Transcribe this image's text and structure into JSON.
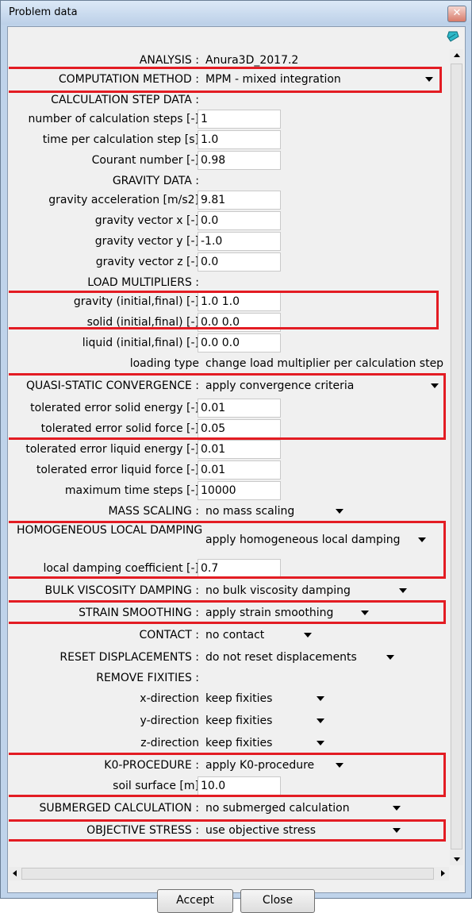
{
  "window": {
    "title": "Problem data",
    "close_glyph": "✕"
  },
  "analysis": {
    "label": "ANALYSIS :",
    "value": "Anura3D_2017.2"
  },
  "computation_method": {
    "label": "COMPUTATION METHOD :",
    "value": "MPM - mixed integration"
  },
  "calc_step": {
    "header": "CALCULATION STEP DATA :",
    "num_steps": {
      "label": "number of calculation steps [-]",
      "value": "1"
    },
    "time_per_step": {
      "label": "time per calculation step [s]",
      "value": "1.0"
    },
    "courant": {
      "label": "Courant number [-]",
      "value": "0.98"
    }
  },
  "gravity": {
    "header": "GRAVITY DATA :",
    "accel": {
      "label": "gravity acceleration [m/s2]",
      "value": "9.81"
    },
    "vx": {
      "label": "gravity vector x [-]",
      "value": "0.0"
    },
    "vy": {
      "label": "gravity vector y [-]",
      "value": "-1.0"
    },
    "vz": {
      "label": "gravity vector z [-]",
      "value": "0.0"
    }
  },
  "load_multipliers": {
    "header": "LOAD MULTIPLIERS :",
    "gravity": {
      "label": "gravity (initial,final) [-]",
      "value": "1.0  1.0"
    },
    "solid": {
      "label": "solid (initial,final) [-]",
      "value": "0.0  0.0"
    },
    "liquid": {
      "label": "liquid (initial,final) [-]",
      "value": "0.0  0.0"
    },
    "loading_type": {
      "label": "loading type",
      "value": "change load multiplier per calculation step"
    }
  },
  "quasi_static": {
    "label": "QUASI-STATIC CONVERGENCE :",
    "value": "apply convergence criteria",
    "err_solid_energy": {
      "label": "tolerated error solid energy [-]",
      "value": "0.01"
    },
    "err_solid_force": {
      "label": "tolerated error solid force [-]",
      "value": "0.05"
    },
    "err_liquid_energy": {
      "label": "tolerated error liquid energy [-]",
      "value": "0.01"
    },
    "err_liquid_force": {
      "label": "tolerated error liquid force [-]",
      "value": "0.01"
    },
    "max_time_steps": {
      "label": "maximum time steps [-]",
      "value": "10000"
    }
  },
  "mass_scaling": {
    "label": "MASS SCALING :",
    "value": "no mass scaling"
  },
  "local_damping": {
    "label": "HOMOGENEOUS LOCAL DAMPING",
    "value": "apply homogeneous local damping",
    "coef": {
      "label": "local damping coefficient [-]",
      "value": "0.7"
    }
  },
  "bulk_viscosity": {
    "label": "BULK VISCOSITY DAMPING :",
    "value": "no bulk viscosity damping"
  },
  "strain_smoothing": {
    "label": "STRAIN SMOOTHING :",
    "value": "apply strain smoothing"
  },
  "contact": {
    "label": "CONTACT :",
    "value": "no contact"
  },
  "reset_displacements": {
    "label": "RESET DISPLACEMENTS :",
    "value": "do not reset displacements"
  },
  "remove_fixities": {
    "header": "REMOVE FIXITIES :",
    "x": {
      "label": "x-direction",
      "value": "keep fixities"
    },
    "y": {
      "label": "y-direction",
      "value": "keep fixities"
    },
    "z": {
      "label": "z-direction",
      "value": "keep fixities"
    }
  },
  "k0": {
    "label": "K0-PROCEDURE :",
    "value": "apply K0-procedure",
    "soil_surface": {
      "label": "soil surface [m]",
      "value": "10.0"
    }
  },
  "submerged": {
    "label": "SUBMERGED CALCULATION :",
    "value": "no submerged calculation"
  },
  "objective_stress": {
    "label": "OBJECTIVE STRESS :",
    "value": "use objective stress"
  },
  "buttons": {
    "accept": "Accept",
    "close": "Close"
  },
  "colors": {
    "highlight": "#e31c23",
    "titlebar": "#bfd3ea",
    "panel": "#f0f0f0"
  },
  "icons": [
    "close-icon",
    "eraser-icon",
    "dropdown-arrow-icon",
    "scroll-up-icon",
    "scroll-down-icon",
    "scroll-left-icon",
    "scroll-right-icon"
  ]
}
